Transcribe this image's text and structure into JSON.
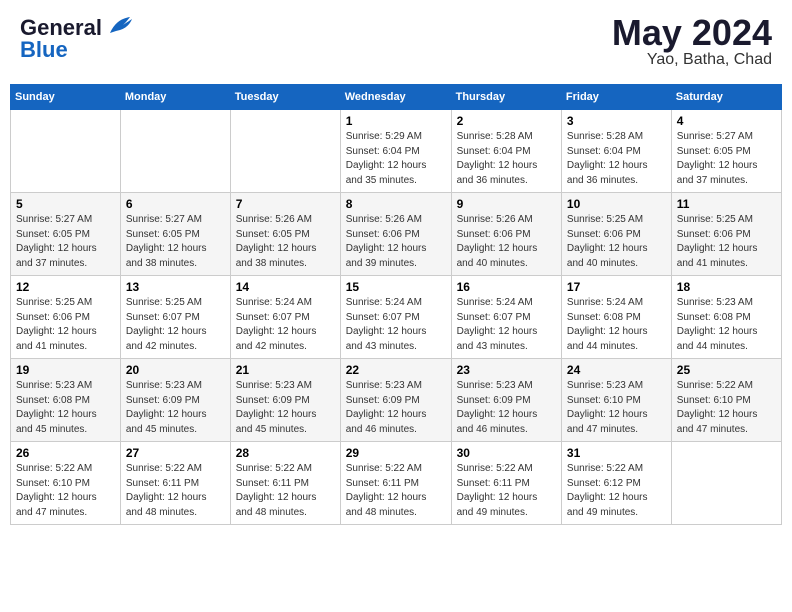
{
  "header": {
    "logo_line1": "General",
    "logo_line2": "Blue",
    "month": "May 2024",
    "location": "Yao, Batha, Chad"
  },
  "weekdays": [
    "Sunday",
    "Monday",
    "Tuesday",
    "Wednesday",
    "Thursday",
    "Friday",
    "Saturday"
  ],
  "weeks": [
    [
      {
        "day": "",
        "info": ""
      },
      {
        "day": "",
        "info": ""
      },
      {
        "day": "",
        "info": ""
      },
      {
        "day": "1",
        "info": "Sunrise: 5:29 AM\nSunset: 6:04 PM\nDaylight: 12 hours\nand 35 minutes."
      },
      {
        "day": "2",
        "info": "Sunrise: 5:28 AM\nSunset: 6:04 PM\nDaylight: 12 hours\nand 36 minutes."
      },
      {
        "day": "3",
        "info": "Sunrise: 5:28 AM\nSunset: 6:04 PM\nDaylight: 12 hours\nand 36 minutes."
      },
      {
        "day": "4",
        "info": "Sunrise: 5:27 AM\nSunset: 6:05 PM\nDaylight: 12 hours\nand 37 minutes."
      }
    ],
    [
      {
        "day": "5",
        "info": "Sunrise: 5:27 AM\nSunset: 6:05 PM\nDaylight: 12 hours\nand 37 minutes."
      },
      {
        "day": "6",
        "info": "Sunrise: 5:27 AM\nSunset: 6:05 PM\nDaylight: 12 hours\nand 38 minutes."
      },
      {
        "day": "7",
        "info": "Sunrise: 5:26 AM\nSunset: 6:05 PM\nDaylight: 12 hours\nand 38 minutes."
      },
      {
        "day": "8",
        "info": "Sunrise: 5:26 AM\nSunset: 6:06 PM\nDaylight: 12 hours\nand 39 minutes."
      },
      {
        "day": "9",
        "info": "Sunrise: 5:26 AM\nSunset: 6:06 PM\nDaylight: 12 hours\nand 40 minutes."
      },
      {
        "day": "10",
        "info": "Sunrise: 5:25 AM\nSunset: 6:06 PM\nDaylight: 12 hours\nand 40 minutes."
      },
      {
        "day": "11",
        "info": "Sunrise: 5:25 AM\nSunset: 6:06 PM\nDaylight: 12 hours\nand 41 minutes."
      }
    ],
    [
      {
        "day": "12",
        "info": "Sunrise: 5:25 AM\nSunset: 6:06 PM\nDaylight: 12 hours\nand 41 minutes."
      },
      {
        "day": "13",
        "info": "Sunrise: 5:25 AM\nSunset: 6:07 PM\nDaylight: 12 hours\nand 42 minutes."
      },
      {
        "day": "14",
        "info": "Sunrise: 5:24 AM\nSunset: 6:07 PM\nDaylight: 12 hours\nand 42 minutes."
      },
      {
        "day": "15",
        "info": "Sunrise: 5:24 AM\nSunset: 6:07 PM\nDaylight: 12 hours\nand 43 minutes."
      },
      {
        "day": "16",
        "info": "Sunrise: 5:24 AM\nSunset: 6:07 PM\nDaylight: 12 hours\nand 43 minutes."
      },
      {
        "day": "17",
        "info": "Sunrise: 5:24 AM\nSunset: 6:08 PM\nDaylight: 12 hours\nand 44 minutes."
      },
      {
        "day": "18",
        "info": "Sunrise: 5:23 AM\nSunset: 6:08 PM\nDaylight: 12 hours\nand 44 minutes."
      }
    ],
    [
      {
        "day": "19",
        "info": "Sunrise: 5:23 AM\nSunset: 6:08 PM\nDaylight: 12 hours\nand 45 minutes."
      },
      {
        "day": "20",
        "info": "Sunrise: 5:23 AM\nSunset: 6:09 PM\nDaylight: 12 hours\nand 45 minutes."
      },
      {
        "day": "21",
        "info": "Sunrise: 5:23 AM\nSunset: 6:09 PM\nDaylight: 12 hours\nand 45 minutes."
      },
      {
        "day": "22",
        "info": "Sunrise: 5:23 AM\nSunset: 6:09 PM\nDaylight: 12 hours\nand 46 minutes."
      },
      {
        "day": "23",
        "info": "Sunrise: 5:23 AM\nSunset: 6:09 PM\nDaylight: 12 hours\nand 46 minutes."
      },
      {
        "day": "24",
        "info": "Sunrise: 5:23 AM\nSunset: 6:10 PM\nDaylight: 12 hours\nand 47 minutes."
      },
      {
        "day": "25",
        "info": "Sunrise: 5:22 AM\nSunset: 6:10 PM\nDaylight: 12 hours\nand 47 minutes."
      }
    ],
    [
      {
        "day": "26",
        "info": "Sunrise: 5:22 AM\nSunset: 6:10 PM\nDaylight: 12 hours\nand 47 minutes."
      },
      {
        "day": "27",
        "info": "Sunrise: 5:22 AM\nSunset: 6:11 PM\nDaylight: 12 hours\nand 48 minutes."
      },
      {
        "day": "28",
        "info": "Sunrise: 5:22 AM\nSunset: 6:11 PM\nDaylight: 12 hours\nand 48 minutes."
      },
      {
        "day": "29",
        "info": "Sunrise: 5:22 AM\nSunset: 6:11 PM\nDaylight: 12 hours\nand 48 minutes."
      },
      {
        "day": "30",
        "info": "Sunrise: 5:22 AM\nSunset: 6:11 PM\nDaylight: 12 hours\nand 49 minutes."
      },
      {
        "day": "31",
        "info": "Sunrise: 5:22 AM\nSunset: 6:12 PM\nDaylight: 12 hours\nand 49 minutes."
      },
      {
        "day": "",
        "info": ""
      }
    ]
  ]
}
